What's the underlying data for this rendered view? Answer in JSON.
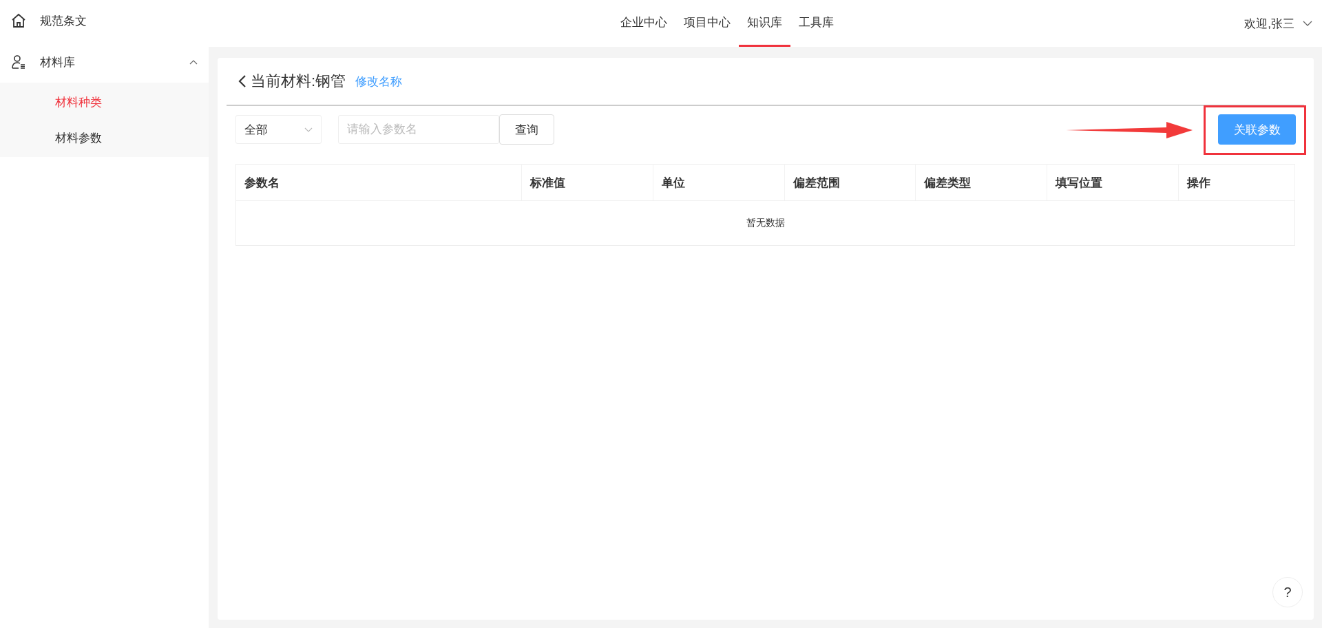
{
  "sidebar": {
    "items": [
      {
        "label": "规范条文",
        "kind": "home"
      },
      {
        "label": "材料库",
        "kind": "user",
        "expanded": true,
        "children": [
          {
            "label": "材料种类",
            "selected": true
          },
          {
            "label": "材料参数",
            "selected": false
          }
        ]
      }
    ]
  },
  "nav": {
    "tabs": [
      {
        "label": "企业中心",
        "selected": false
      },
      {
        "label": "项目中心",
        "selected": false
      },
      {
        "label": "知识库",
        "selected": true
      },
      {
        "label": "工具库",
        "selected": false
      }
    ],
    "user": "欢迎,张三"
  },
  "page": {
    "title": "当前材料:钢管",
    "rename_link": "修改名称",
    "filter": {
      "value": "全部"
    },
    "search": {
      "placeholder": "请输入参数名"
    },
    "query_button": "查询",
    "relate_button": "关联参数"
  },
  "table": {
    "columns": [
      "参数名",
      "标准值",
      "单位",
      "偏差范围",
      "偏差类型",
      "填写位置",
      "操作"
    ],
    "empty_text": "暂无数据"
  },
  "help_button": "?"
}
